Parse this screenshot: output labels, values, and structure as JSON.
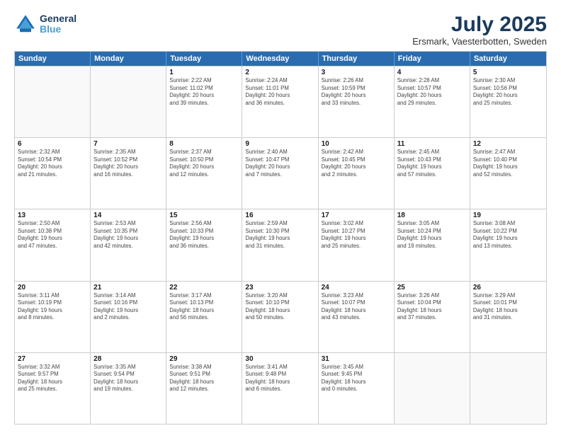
{
  "header": {
    "logo_line1": "General",
    "logo_line2": "Blue",
    "month": "July 2025",
    "location": "Ersmark, Vaesterbotten, Sweden"
  },
  "weekdays": [
    "Sunday",
    "Monday",
    "Tuesday",
    "Wednesday",
    "Thursday",
    "Friday",
    "Saturday"
  ],
  "weeks": [
    [
      {
        "day": "",
        "info": ""
      },
      {
        "day": "",
        "info": ""
      },
      {
        "day": "1",
        "info": "Sunrise: 2:22 AM\nSunset: 11:02 PM\nDaylight: 20 hours\nand 39 minutes."
      },
      {
        "day": "2",
        "info": "Sunrise: 2:24 AM\nSunset: 11:01 PM\nDaylight: 20 hours\nand 36 minutes."
      },
      {
        "day": "3",
        "info": "Sunrise: 2:26 AM\nSunset: 10:59 PM\nDaylight: 20 hours\nand 33 minutes."
      },
      {
        "day": "4",
        "info": "Sunrise: 2:28 AM\nSunset: 10:57 PM\nDaylight: 20 hours\nand 29 minutes."
      },
      {
        "day": "5",
        "info": "Sunrise: 2:30 AM\nSunset: 10:56 PM\nDaylight: 20 hours\nand 25 minutes."
      }
    ],
    [
      {
        "day": "6",
        "info": "Sunrise: 2:32 AM\nSunset: 10:54 PM\nDaylight: 20 hours\nand 21 minutes."
      },
      {
        "day": "7",
        "info": "Sunrise: 2:35 AM\nSunset: 10:52 PM\nDaylight: 20 hours\nand 16 minutes."
      },
      {
        "day": "8",
        "info": "Sunrise: 2:37 AM\nSunset: 10:50 PM\nDaylight: 20 hours\nand 12 minutes."
      },
      {
        "day": "9",
        "info": "Sunrise: 2:40 AM\nSunset: 10:47 PM\nDaylight: 20 hours\nand 7 minutes."
      },
      {
        "day": "10",
        "info": "Sunrise: 2:42 AM\nSunset: 10:45 PM\nDaylight: 20 hours\nand 2 minutes."
      },
      {
        "day": "11",
        "info": "Sunrise: 2:45 AM\nSunset: 10:43 PM\nDaylight: 19 hours\nand 57 minutes."
      },
      {
        "day": "12",
        "info": "Sunrise: 2:47 AM\nSunset: 10:40 PM\nDaylight: 19 hours\nand 52 minutes."
      }
    ],
    [
      {
        "day": "13",
        "info": "Sunrise: 2:50 AM\nSunset: 10:38 PM\nDaylight: 19 hours\nand 47 minutes."
      },
      {
        "day": "14",
        "info": "Sunrise: 2:53 AM\nSunset: 10:35 PM\nDaylight: 19 hours\nand 42 minutes."
      },
      {
        "day": "15",
        "info": "Sunrise: 2:56 AM\nSunset: 10:33 PM\nDaylight: 19 hours\nand 36 minutes."
      },
      {
        "day": "16",
        "info": "Sunrise: 2:59 AM\nSunset: 10:30 PM\nDaylight: 19 hours\nand 31 minutes."
      },
      {
        "day": "17",
        "info": "Sunrise: 3:02 AM\nSunset: 10:27 PM\nDaylight: 19 hours\nand 25 minutes."
      },
      {
        "day": "18",
        "info": "Sunrise: 3:05 AM\nSunset: 10:24 PM\nDaylight: 19 hours\nand 19 minutes."
      },
      {
        "day": "19",
        "info": "Sunrise: 3:08 AM\nSunset: 10:22 PM\nDaylight: 19 hours\nand 13 minutes."
      }
    ],
    [
      {
        "day": "20",
        "info": "Sunrise: 3:11 AM\nSunset: 10:19 PM\nDaylight: 19 hours\nand 8 minutes."
      },
      {
        "day": "21",
        "info": "Sunrise: 3:14 AM\nSunset: 10:16 PM\nDaylight: 19 hours\nand 2 minutes."
      },
      {
        "day": "22",
        "info": "Sunrise: 3:17 AM\nSunset: 10:13 PM\nDaylight: 18 hours\nand 56 minutes."
      },
      {
        "day": "23",
        "info": "Sunrise: 3:20 AM\nSunset: 10:10 PM\nDaylight: 18 hours\nand 50 minutes."
      },
      {
        "day": "24",
        "info": "Sunrise: 3:23 AM\nSunset: 10:07 PM\nDaylight: 18 hours\nand 43 minutes."
      },
      {
        "day": "25",
        "info": "Sunrise: 3:26 AM\nSunset: 10:04 PM\nDaylight: 18 hours\nand 37 minutes."
      },
      {
        "day": "26",
        "info": "Sunrise: 3:29 AM\nSunset: 10:01 PM\nDaylight: 18 hours\nand 31 minutes."
      }
    ],
    [
      {
        "day": "27",
        "info": "Sunrise: 3:32 AM\nSunset: 9:57 PM\nDaylight: 18 hours\nand 25 minutes."
      },
      {
        "day": "28",
        "info": "Sunrise: 3:35 AM\nSunset: 9:54 PM\nDaylight: 18 hours\nand 19 minutes."
      },
      {
        "day": "29",
        "info": "Sunrise: 3:38 AM\nSunset: 9:51 PM\nDaylight: 18 hours\nand 12 minutes."
      },
      {
        "day": "30",
        "info": "Sunrise: 3:41 AM\nSunset: 9:48 PM\nDaylight: 18 hours\nand 6 minutes."
      },
      {
        "day": "31",
        "info": "Sunrise: 3:45 AM\nSunset: 9:45 PM\nDaylight: 18 hours\nand 0 minutes."
      },
      {
        "day": "",
        "info": ""
      },
      {
        "day": "",
        "info": ""
      }
    ]
  ]
}
